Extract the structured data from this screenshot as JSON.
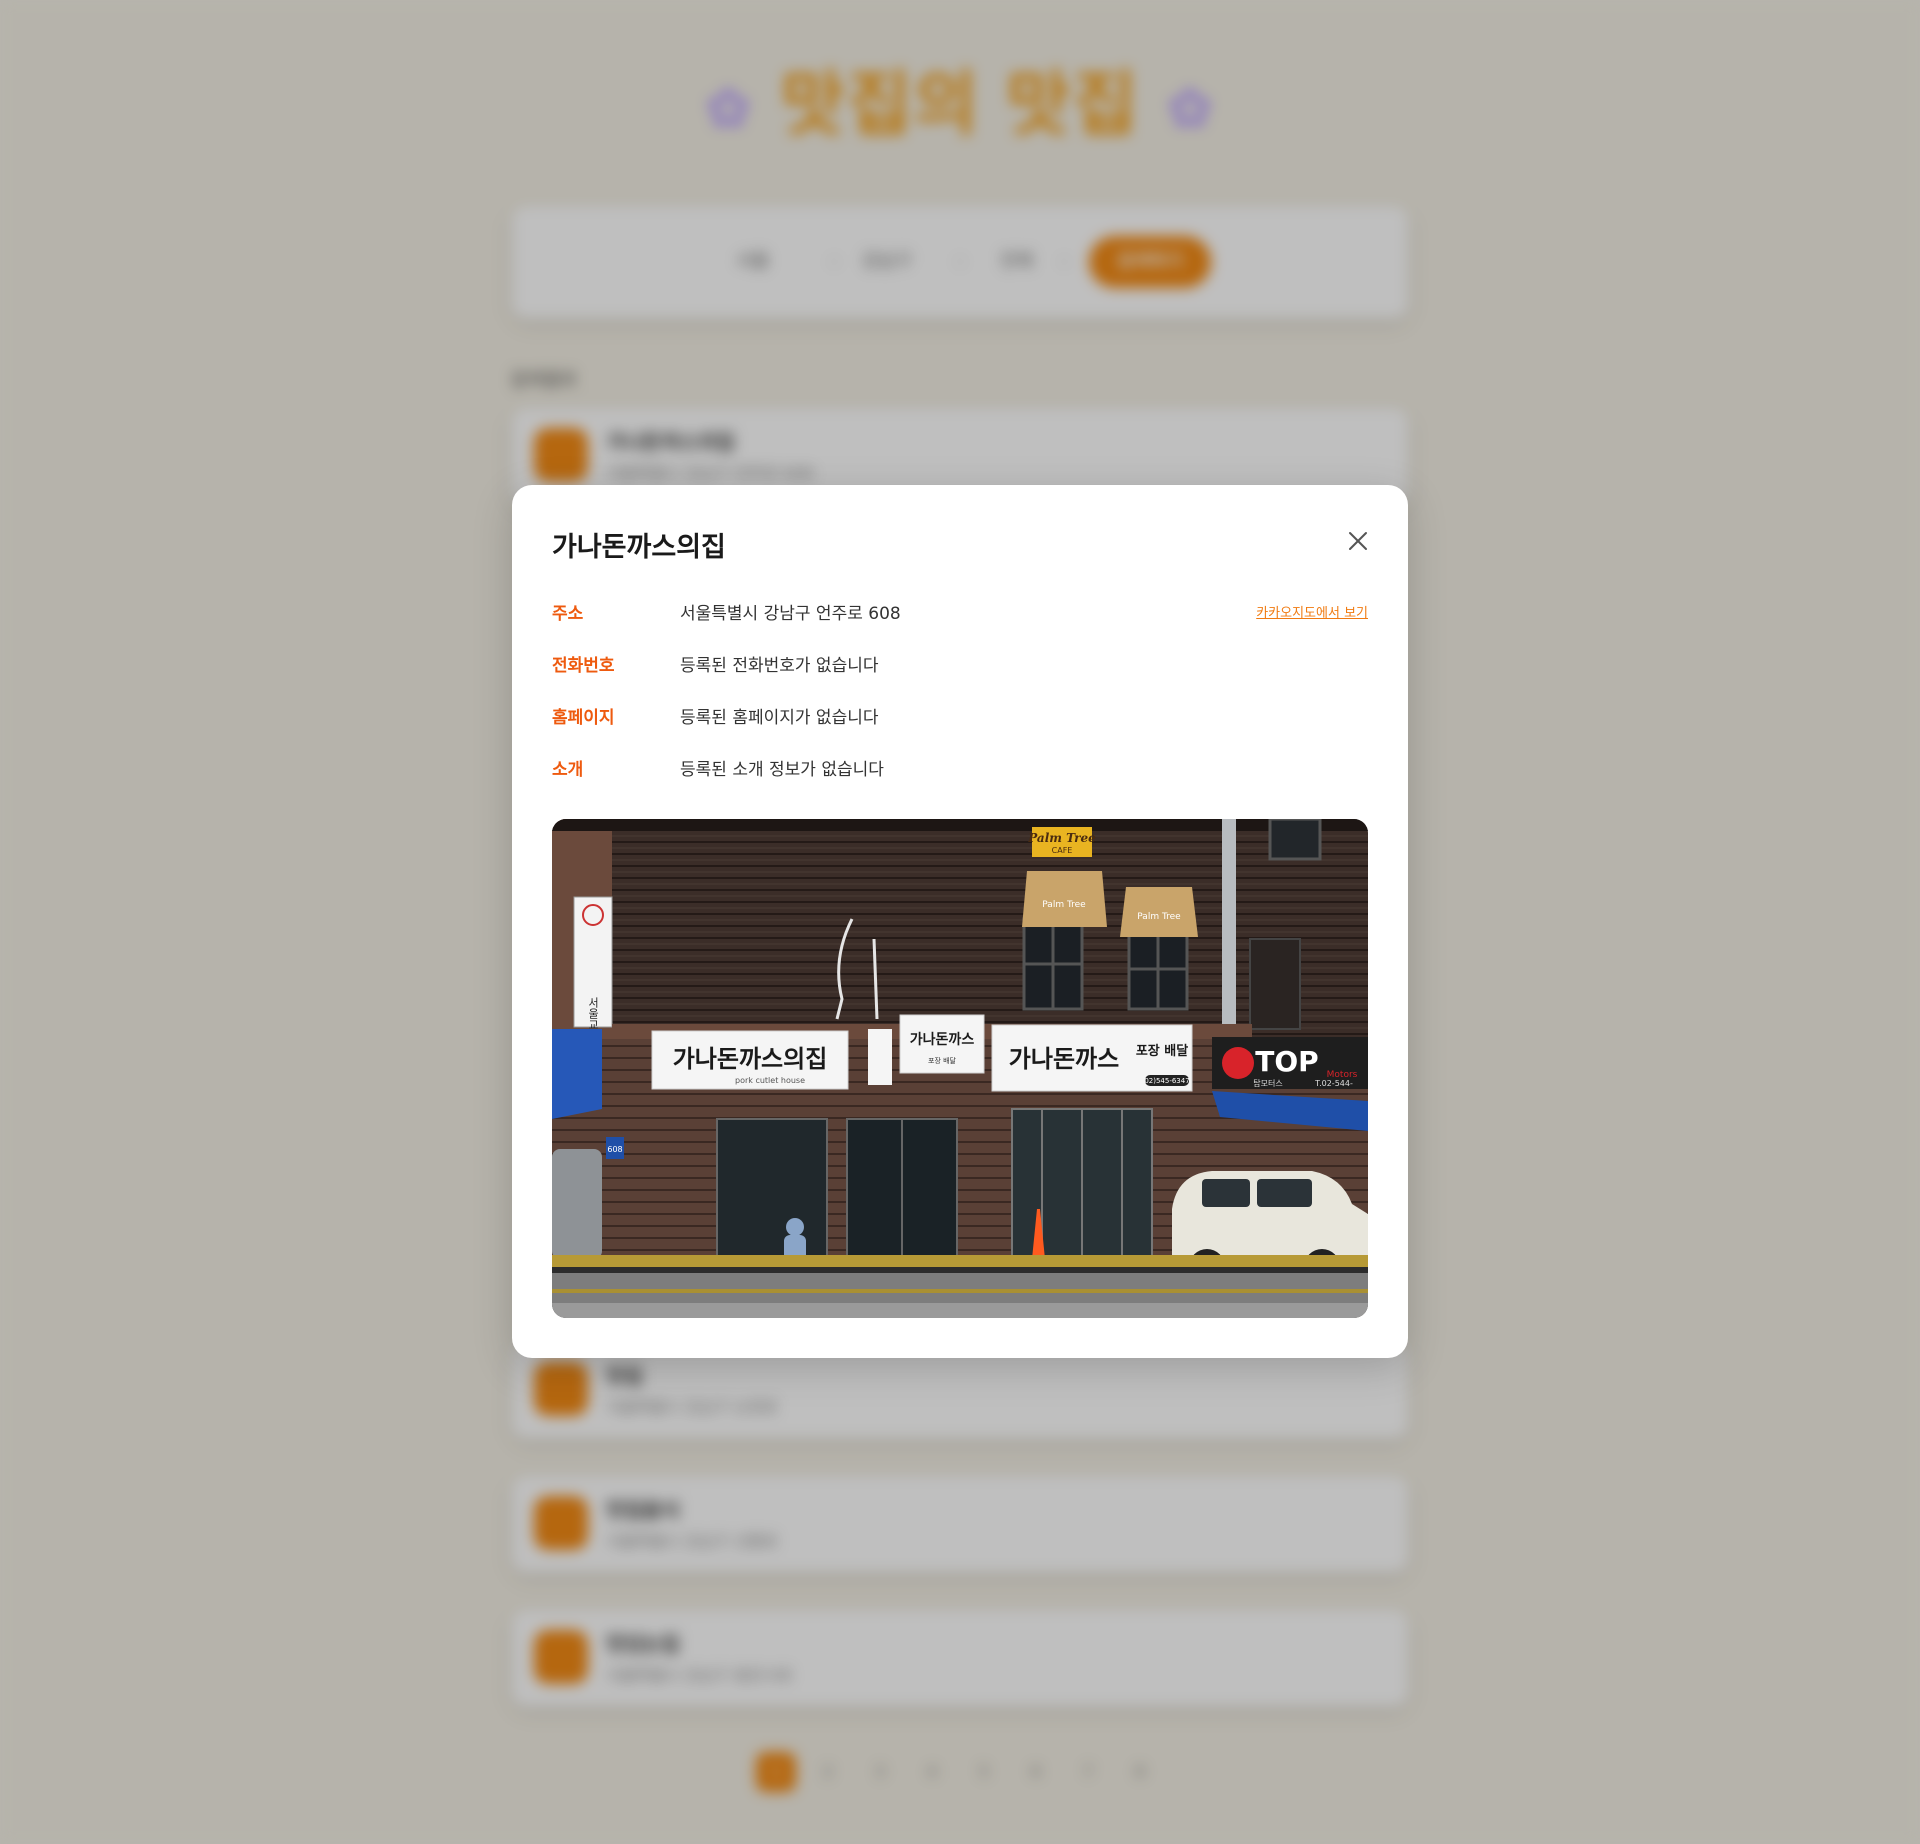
{
  "background": {
    "site_title": "맛집의 맛집",
    "title_deco_left": "✿",
    "title_deco_right": "✿",
    "filters": [
      {
        "label": "서울"
      },
      {
        "label": "강남구"
      },
      {
        "label": "전체"
      }
    ],
    "search_button": "검색하기",
    "result_count": "검색결과",
    "list": [
      {
        "name": "가나돈까스의집",
        "address": "서울특별시 강남구 언주로 608"
      },
      {
        "name": "맛집",
        "address": "서울특별시 강남구 논현로"
      },
      {
        "name": "맛집음식",
        "address": "서울특별시 강남구 선릉로"
      },
      {
        "name": "맛있는집",
        "address": "서울특별시 강남구 봉은사로"
      }
    ],
    "pages": [
      "1",
      "2",
      "3",
      "4",
      "5",
      "6",
      "7",
      "8"
    ]
  },
  "modal": {
    "title": "가나돈까스의집",
    "rows": [
      {
        "label": "주소",
        "value": "서울특별시 강남구 언주로 608"
      },
      {
        "label": "전화번호",
        "value": "등록된 전화번호가 없습니다"
      },
      {
        "label": "홈페이지",
        "value": "등록된 홈페이지가 없습니다"
      },
      {
        "label": "소개",
        "value": "등록된 소개 정보가 없습니다"
      }
    ],
    "map_link": "카카오지도에서 보기",
    "photo": {
      "sign_main": "가나돈까스의집",
      "sign_sub": "pork cutlet house",
      "sign_right": "가나돈까스",
      "sign_takeout": "포장 배달",
      "sign_phone": "02)545-6347",
      "sign_top": "TOP",
      "sign_top_sub": "Motors",
      "sign_top_kr": "탑모터스",
      "sign_top_phone": "T.02-544-",
      "sign_cafe": "Palm Tree",
      "sign_cafe_sub": "CAFE",
      "sign_church": "서울교회",
      "sign_number": "608"
    }
  },
  "colors": {
    "accent": "#f28a15",
    "label": "#ee5a0f",
    "link": "#f07a10"
  }
}
